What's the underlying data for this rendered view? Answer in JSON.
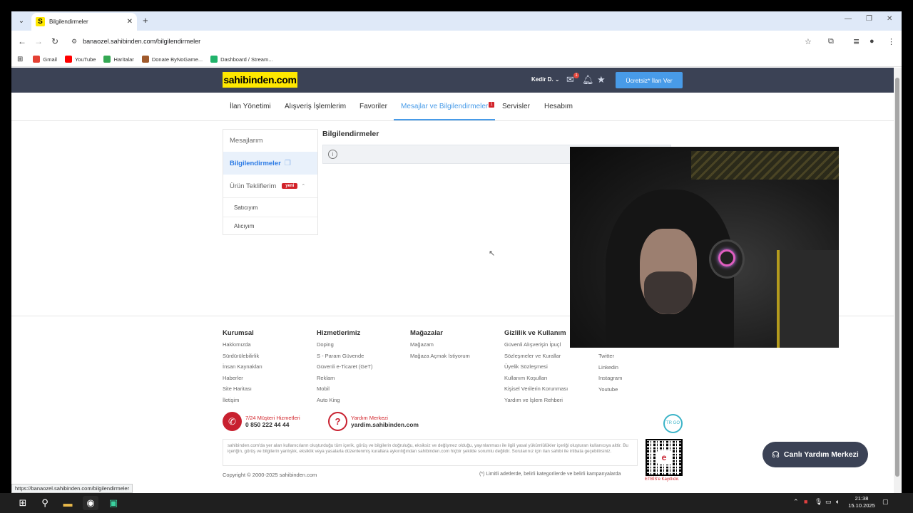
{
  "browser": {
    "tab_title": "Bilgilendirmeler",
    "favicon_letter": "S",
    "new_tab": "+",
    "url": "banaozel.sahibinden.com/bilgilendirmeler",
    "bookmarks": [
      "Gmail",
      "YouTube",
      "Haritalar",
      "Donate ByNoGame...",
      "Dashboard / Stream..."
    ],
    "status_url": "https://banaozel.sahibinden.com/bilgilendirmeler"
  },
  "header": {
    "logo": "sahibinden.com",
    "user": "Kedir D.",
    "message_badge": "1",
    "post_button": "Ücretsiz* İlan Ver"
  },
  "nav": {
    "items": [
      "İlan Yönetimi",
      "Alışveriş İşlemlerim",
      "Favoriler",
      "Mesajlar ve Bilgilendirmeler",
      "Servisler",
      "Hesabım"
    ],
    "badge": "1"
  },
  "sidebar": {
    "messages": "Mesajlarım",
    "notifications": "Bilgilendirmeler",
    "offers": "Ürün Tekliflerim",
    "offers_badge": "yeni",
    "seller": "Satıcıyım",
    "buyer": "Alıcıyım"
  },
  "main": {
    "title": "Bilgilendirmeler",
    "info_icon": "i"
  },
  "footer": {
    "columns": [
      {
        "head": "Kurumsal",
        "links": [
          "Hakkımızda",
          "Sürdürülebilirlik",
          "İnsan Kaynakları",
          "Haberler",
          "Site Haritası",
          "İletişim"
        ]
      },
      {
        "head": "Hizmetlerimiz",
        "links": [
          "Doping",
          "S - Param Güvende",
          "Güvenli e-Ticaret (GeT)",
          "Reklam",
          "Mobil",
          "Auto King"
        ]
      },
      {
        "head": "Mağazalar",
        "links": [
          "Mağazam",
          "Mağaza Açmak İstiyorum"
        ]
      },
      {
        "head": "Gizlilik ve Kullanım",
        "links": [
          "Güvenli Alışverişin İpuçl",
          "Sözleşmeler ve Kurallar",
          "Üyelik Sözleşmesi",
          "Kullanım Koşulları",
          "Kişisel Verilerin Korunması",
          "Yardım ve İşlem Rehberi"
        ]
      },
      {
        "head": "",
        "links": [
          "",
          "Twitter",
          "Linkedin",
          "Instagram",
          "Youtube"
        ]
      }
    ],
    "support_line1": "7/24 Müşteri Hizmetleri",
    "support_phone": "0 850 222 44 44",
    "help_line1": "Yardım Merkezi",
    "help_site": "yardim.sahibinden.com",
    "trgo": "TR GO",
    "disclaimer": "sahibinden.com'da yer alan kullanıcıların oluşturduğu tüm içerik, görüş ve bilgilerin doğruluğu, eksiksiz ve değişmez olduğu, yayınlanması ile ilgili yasal yükümlülükler içeriği oluşturan kullanıcıya aittir. Bu içeriğin, görüş ve bilgilerin yanlışlık, eksiklik veya yasalarla düzenlenmiş kurallara aykırılığından sahibinden.com hiçbir şekilde sorumlu değildir. Sorularınız için ilan sahibi ile irtibata geçebilirsiniz.",
    "copyright": "Copyright © 2000-2025 sahibinden.com",
    "limit_note": "(*) Limitli adetlerde, belirli kategorilerde ve belirli kampanyalarda",
    "etbis": "ETBİS'e Kayıtlıdır.",
    "live_help": "Canlı Yardım Merkezi"
  },
  "taskbar": {
    "time": "21:38",
    "date": "15.10.2025"
  }
}
